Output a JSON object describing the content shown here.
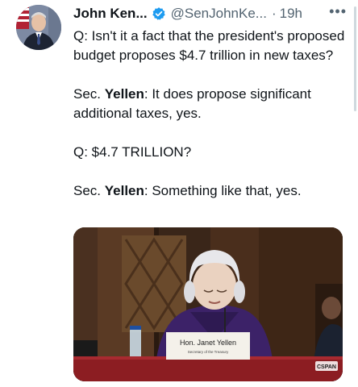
{
  "author": {
    "name": "John Ken...",
    "handle": "@SenJohnKe...",
    "separator": "·",
    "time": "19h"
  },
  "menu_icon": "more-horizontal-icon",
  "tweet_lines": {
    "q1": "Q: Isn't it a fact that the president's proposed budget proposes $4.7 trillion in new taxes?",
    "a1_prefix": "Sec. ",
    "a1_name": "Yellen",
    "a1_text": ": It does propose significant additional taxes, yes.",
    "q2": "Q: $4.7 TRILLION?",
    "a2_prefix": "Sec. ",
    "a2_name": "Yellen",
    "a2_text": ": Something like that, yes."
  },
  "media": {
    "nameplate_name": "Hon. Janet Yellen",
    "nameplate_title": "Secretary of the Treasury",
    "badge": "CSPAN"
  },
  "colors": {
    "verified": "#1d9bf0",
    "text": "#0f1419",
    "secondary": "#536471"
  }
}
